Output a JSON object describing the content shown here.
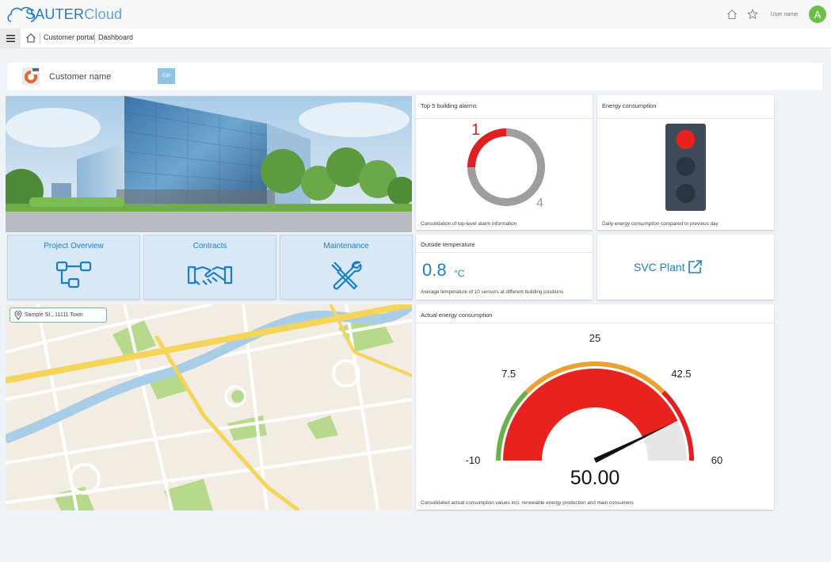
{
  "app": {
    "logo_text_bold": "SAUTER",
    "logo_text_thin": "Cloud",
    "user_name": "User name",
    "avatar_letter": "A",
    "accent_color": "#1d7ec3"
  },
  "breadcrumb": {
    "items": [
      "Customer portal",
      "Dashboard"
    ]
  },
  "customer": {
    "name": "Customer name",
    "edit_label": "Edit"
  },
  "tiles": [
    {
      "label": "Project Overview",
      "icon": "hierarchy-icon"
    },
    {
      "label": "Contracts",
      "icon": "handshake-icon"
    },
    {
      "label": "Maintenance",
      "icon": "tools-icon"
    }
  ],
  "map": {
    "address": "Sample St., 11111 Town"
  },
  "alarms_card": {
    "title": "Top 5 building alarms",
    "active_count": "1",
    "total_count": "4",
    "active_fraction": 0.25,
    "caption": "Consolidation of top-level alarm information"
  },
  "energy_card": {
    "title": "Energy consumption",
    "active_light": "red",
    "caption": "Daily energy consumption compared to previous day"
  },
  "temperature_card": {
    "title": "Outside temperature",
    "value": "0.8",
    "unit": "°C",
    "caption": "Average temperature of 10 sensors at different building positions"
  },
  "svc_card": {
    "label": "SVC Plant",
    "icon": "external-link-icon"
  },
  "gauge_card": {
    "title": "Actual energy consumption",
    "min": -10,
    "max": 60,
    "value": 50,
    "value_text": "50.00",
    "tick_labels": [
      "-10",
      "7.5",
      "25",
      "42.5",
      "60"
    ],
    "ticks": [
      -10,
      7.5,
      25,
      42.5,
      60
    ],
    "bands": [
      {
        "from": -10,
        "to": 7.5,
        "color": "#6ab04c"
      },
      {
        "from": 7.5,
        "to": 42.5,
        "color": "#f0a030"
      },
      {
        "from": 42.5,
        "to": 60,
        "color": "#e02020"
      }
    ],
    "fill_color": "#e8221f",
    "caption": "Consolidated actual consumption values incl. renewable energy production and main consumers"
  }
}
